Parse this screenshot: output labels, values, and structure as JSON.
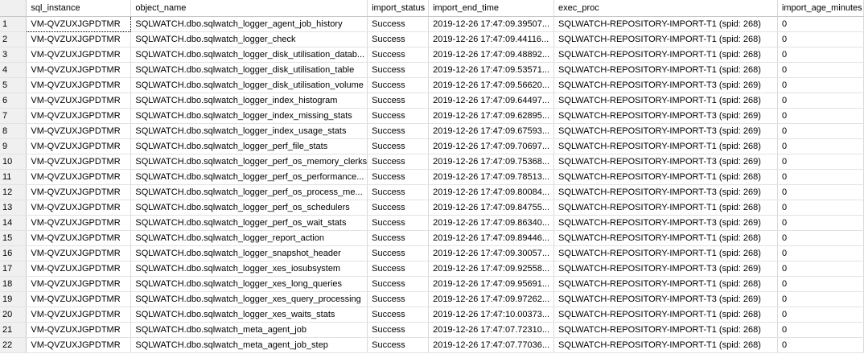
{
  "columns": [
    "",
    "sql_instance",
    "object_name",
    "import_status",
    "import_end_time",
    "exec_proc",
    "import_age_minutes"
  ],
  "rows": [
    [
      "1",
      "VM-QVZUXJGPDTMR",
      "SQLWATCH.dbo.sqlwatch_logger_agent_job_history",
      "Success",
      "2019-12-26 17:47:09.39507...",
      "SQLWATCH-REPOSITORY-IMPORT-T1 (spid: 268)",
      "0"
    ],
    [
      "2",
      "VM-QVZUXJGPDTMR",
      "SQLWATCH.dbo.sqlwatch_logger_check",
      "Success",
      "2019-12-26 17:47:09.44116...",
      "SQLWATCH-REPOSITORY-IMPORT-T1 (spid: 268)",
      "0"
    ],
    [
      "3",
      "VM-QVZUXJGPDTMR",
      "SQLWATCH.dbo.sqlwatch_logger_disk_utilisation_datab...",
      "Success",
      "2019-12-26 17:47:09.48892...",
      "SQLWATCH-REPOSITORY-IMPORT-T1 (spid: 268)",
      "0"
    ],
    [
      "4",
      "VM-QVZUXJGPDTMR",
      "SQLWATCH.dbo.sqlwatch_logger_disk_utilisation_table",
      "Success",
      "2019-12-26 17:47:09.53571...",
      "SQLWATCH-REPOSITORY-IMPORT-T1 (spid: 268)",
      "0"
    ],
    [
      "5",
      "VM-QVZUXJGPDTMR",
      "SQLWATCH.dbo.sqlwatch_logger_disk_utilisation_volume",
      "Success",
      "2019-12-26 17:47:09.56620...",
      "SQLWATCH-REPOSITORY-IMPORT-T3 (spid: 269)",
      "0"
    ],
    [
      "6",
      "VM-QVZUXJGPDTMR",
      "SQLWATCH.dbo.sqlwatch_logger_index_histogram",
      "Success",
      "2019-12-26 17:47:09.64497...",
      "SQLWATCH-REPOSITORY-IMPORT-T1 (spid: 268)",
      "0"
    ],
    [
      "7",
      "VM-QVZUXJGPDTMR",
      "SQLWATCH.dbo.sqlwatch_logger_index_missing_stats",
      "Success",
      "2019-12-26 17:47:09.62895...",
      "SQLWATCH-REPOSITORY-IMPORT-T3 (spid: 269)",
      "0"
    ],
    [
      "8",
      "VM-QVZUXJGPDTMR",
      "SQLWATCH.dbo.sqlwatch_logger_index_usage_stats",
      "Success",
      "2019-12-26 17:47:09.67593...",
      "SQLWATCH-REPOSITORY-IMPORT-T3 (spid: 269)",
      "0"
    ],
    [
      "9",
      "VM-QVZUXJGPDTMR",
      "SQLWATCH.dbo.sqlwatch_logger_perf_file_stats",
      "Success",
      "2019-12-26 17:47:09.70697...",
      "SQLWATCH-REPOSITORY-IMPORT-T1 (spid: 268)",
      "0"
    ],
    [
      "10",
      "VM-QVZUXJGPDTMR",
      "SQLWATCH.dbo.sqlwatch_logger_perf_os_memory_clerks",
      "Success",
      "2019-12-26 17:47:09.75368...",
      "SQLWATCH-REPOSITORY-IMPORT-T3 (spid: 269)",
      "0"
    ],
    [
      "11",
      "VM-QVZUXJGPDTMR",
      "SQLWATCH.dbo.sqlwatch_logger_perf_os_performance...",
      "Success",
      "2019-12-26 17:47:09.78513...",
      "SQLWATCH-REPOSITORY-IMPORT-T1 (spid: 268)",
      "0"
    ],
    [
      "12",
      "VM-QVZUXJGPDTMR",
      "SQLWATCH.dbo.sqlwatch_logger_perf_os_process_me...",
      "Success",
      "2019-12-26 17:47:09.80084...",
      "SQLWATCH-REPOSITORY-IMPORT-T3 (spid: 269)",
      "0"
    ],
    [
      "13",
      "VM-QVZUXJGPDTMR",
      "SQLWATCH.dbo.sqlwatch_logger_perf_os_schedulers",
      "Success",
      "2019-12-26 17:47:09.84755...",
      "SQLWATCH-REPOSITORY-IMPORT-T1 (spid: 268)",
      "0"
    ],
    [
      "14",
      "VM-QVZUXJGPDTMR",
      "SQLWATCH.dbo.sqlwatch_logger_perf_os_wait_stats",
      "Success",
      "2019-12-26 17:47:09.86340...",
      "SQLWATCH-REPOSITORY-IMPORT-T3 (spid: 269)",
      "0"
    ],
    [
      "15",
      "VM-QVZUXJGPDTMR",
      "SQLWATCH.dbo.sqlwatch_logger_report_action",
      "Success",
      "2019-12-26 17:47:09.89446...",
      "SQLWATCH-REPOSITORY-IMPORT-T1 (spid: 268)",
      "0"
    ],
    [
      "16",
      "VM-QVZUXJGPDTMR",
      "SQLWATCH.dbo.sqlwatch_logger_snapshot_header",
      "Success",
      "2019-12-26 17:47:09.30057...",
      "SQLWATCH-REPOSITORY-IMPORT-T1 (spid: 268)",
      "0"
    ],
    [
      "17",
      "VM-QVZUXJGPDTMR",
      "SQLWATCH.dbo.sqlwatch_logger_xes_iosubsystem",
      "Success",
      "2019-12-26 17:47:09.92558...",
      "SQLWATCH-REPOSITORY-IMPORT-T3 (spid: 269)",
      "0"
    ],
    [
      "18",
      "VM-QVZUXJGPDTMR",
      "SQLWATCH.dbo.sqlwatch_logger_xes_long_queries",
      "Success",
      "2019-12-26 17:47:09.95691...",
      "SQLWATCH-REPOSITORY-IMPORT-T1 (spid: 268)",
      "0"
    ],
    [
      "19",
      "VM-QVZUXJGPDTMR",
      "SQLWATCH.dbo.sqlwatch_logger_xes_query_processing",
      "Success",
      "2019-12-26 17:47:09.97262...",
      "SQLWATCH-REPOSITORY-IMPORT-T3 (spid: 269)",
      "0"
    ],
    [
      "20",
      "VM-QVZUXJGPDTMR",
      "SQLWATCH.dbo.sqlwatch_logger_xes_waits_stats",
      "Success",
      "2019-12-26 17:47:10.00373...",
      "SQLWATCH-REPOSITORY-IMPORT-T1 (spid: 268)",
      "0"
    ],
    [
      "21",
      "VM-QVZUXJGPDTMR",
      "SQLWATCH.dbo.sqlwatch_meta_agent_job",
      "Success",
      "2019-12-26 17:47:07.72310...",
      "SQLWATCH-REPOSITORY-IMPORT-T1 (spid: 268)",
      "0"
    ],
    [
      "22",
      "VM-QVZUXJGPDTMR",
      "SQLWATCH.dbo.sqlwatch_meta_agent_job_step",
      "Success",
      "2019-12-26 17:47:07.77036...",
      "SQLWATCH-REPOSITORY-IMPORT-T1 (spid: 268)",
      "0"
    ]
  ]
}
